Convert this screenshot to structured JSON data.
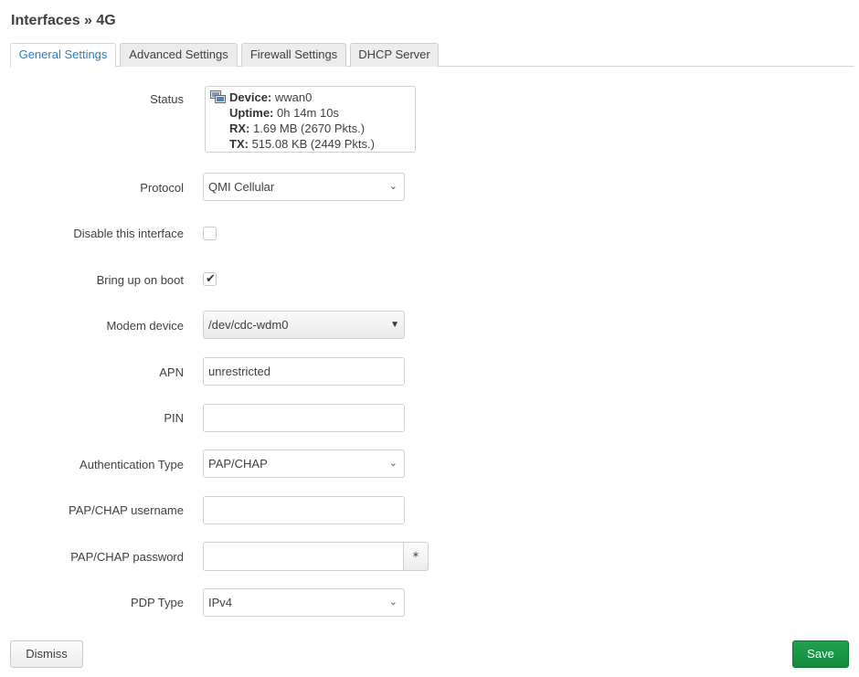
{
  "page": {
    "title": "Interfaces » 4G"
  },
  "tabs": [
    {
      "label": "General Settings",
      "active": true
    },
    {
      "label": "Advanced Settings",
      "active": false
    },
    {
      "label": "Firewall Settings",
      "active": false
    },
    {
      "label": "DHCP Server",
      "active": false
    }
  ],
  "form": {
    "status": {
      "label": "Status",
      "device_key": "Device:",
      "device_val": " wwan0",
      "uptime_key": "Uptime:",
      "uptime_val": " 0h 14m 10s",
      "rx_key": "RX:",
      "rx_val": " 1.69 MB (2670 Pkts.)",
      "tx_key": "TX:",
      "tx_val": " 515.08 KB (2449 Pkts.)",
      "icon": "network-interface-icon"
    },
    "protocol": {
      "label": "Protocol",
      "value": "QMI Cellular"
    },
    "disable": {
      "label": "Disable this interface",
      "checked": false
    },
    "bootup": {
      "label": "Bring up on boot",
      "checked": true
    },
    "modem": {
      "label": "Modem device",
      "value": "/dev/cdc-wdm0"
    },
    "apn": {
      "label": "APN",
      "value": "unrestricted"
    },
    "pin": {
      "label": "PIN",
      "value": ""
    },
    "auth": {
      "label": "Authentication Type",
      "value": "PAP/CHAP"
    },
    "username": {
      "label": "PAP/CHAP username",
      "value": ""
    },
    "password": {
      "label": "PAP/CHAP password",
      "value": "",
      "reveal_label": "∗"
    },
    "pdp": {
      "label": "PDP Type",
      "value": "IPv4"
    }
  },
  "actions": {
    "dismiss_label": "Dismiss",
    "save_label": "Save"
  },
  "colors": {
    "accent": "#2a7fc0",
    "save": "#1a9447"
  }
}
